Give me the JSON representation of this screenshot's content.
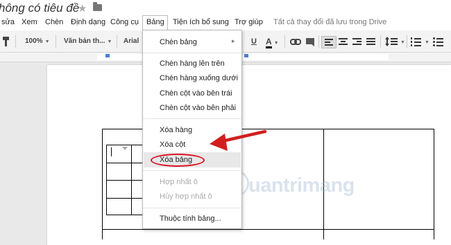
{
  "document": {
    "title": "hông có tiêu đề",
    "star_icon": "★",
    "folder_icon": "folder-icon"
  },
  "menubar": {
    "items": [
      {
        "label": "sửa"
      },
      {
        "label": "Xem"
      },
      {
        "label": "Chèn"
      },
      {
        "label": "Định dạng"
      },
      {
        "label": "Công cụ"
      },
      {
        "label": "Bảng"
      },
      {
        "label": "Tiện ích bổ sung"
      },
      {
        "label": "Trợ giúp"
      }
    ],
    "save_status": "Tất cả thay đổi đã lưu trong Drive"
  },
  "toolbar": {
    "zoom": "100%",
    "style": "Văn bản th...",
    "font": "Arial",
    "underline": "U",
    "text_color": "A"
  },
  "dropdown": {
    "items": [
      {
        "label": "Chèn bảng",
        "enabled": true,
        "submenu": "▸"
      },
      {
        "label": "Chèn hàng lên trên",
        "enabled": true
      },
      {
        "label": "Chèn hàng xuống dưới",
        "enabled": true
      },
      {
        "label": "Chèn cột vào bên trái",
        "enabled": true
      },
      {
        "label": "Chèn cột vào bên phải",
        "enabled": true
      },
      {
        "label": "Xóa hàng",
        "enabled": true
      },
      {
        "label": "Xóa cột",
        "enabled": true
      },
      {
        "label": "Xóa bảng",
        "enabled": true
      },
      {
        "label": "Hợp nhất ô",
        "enabled": false
      },
      {
        "label": "Hủy hợp nhất ô",
        "enabled": false
      },
      {
        "label": "Thuộc tính bảng...",
        "enabled": true
      }
    ]
  },
  "watermark": "uantrimang",
  "colors": {
    "annotation_red": "#d11f1f",
    "menu_hover": "#e8e8e8",
    "toolbar_bg": "#f3f3f3"
  }
}
